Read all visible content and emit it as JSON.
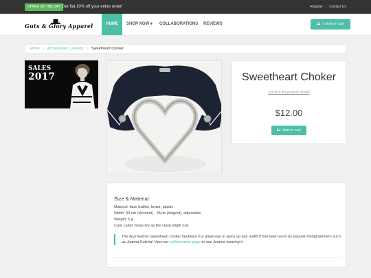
{
  "topbar": {
    "offer_badge": "OFFER OF THE DAY",
    "offer_text": "Get flat 10% off your entire order!",
    "register": "Register",
    "separator": "|",
    "contact": "Contact Us"
  },
  "brand": {
    "logo_text": "Guts & Glory Apparel"
  },
  "nav": {
    "home": "HOME",
    "shop": "SHOP NOW",
    "collaborations": "COLLABORATIONS",
    "reviews": "REVIEWS",
    "cart": "3 items in cart"
  },
  "breadcrumb": {
    "home": "Home",
    "sep": ">",
    "category": "Accessories | Jewelry",
    "current": "Sweetheart Choker"
  },
  "banner": {
    "sales_label": "SALES",
    "year": "2017"
  },
  "product": {
    "title": "Sweetheart Choker",
    "scroll_link": "Scroll to the product details",
    "price": "$12.00",
    "add_to_cart": "Add to cart"
  },
  "details": {
    "heading": "Size & Material",
    "material": "Material: faux leather, brass, plastic",
    "width": "Width: 30 cm (shortest) - 35cm (longest), adjustable",
    "weight": "Weight: 6 g",
    "care": "Care Label: Keep dry as the clasp might rust.",
    "quote_part1": "The faux leather sweetheart choker necklace is a great way to spice up any outfit! It has been worn by popular instagrammers such as Joanna Kutcha! View our",
    "quote_link": "collaboration page",
    "quote_part2": "to see Joanna wearing it."
  },
  "colors": {
    "accent": "#4dbea8",
    "topbar": "#333333",
    "offer_badge": "#5cb85c"
  }
}
